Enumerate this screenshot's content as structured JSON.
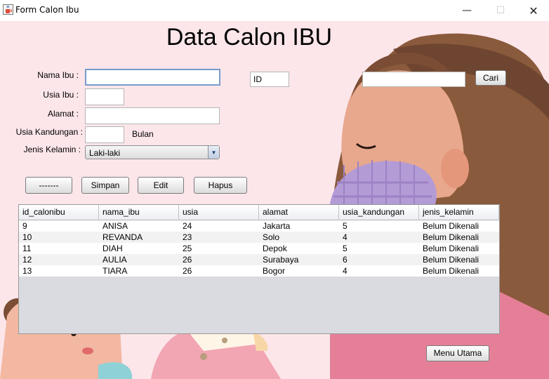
{
  "window": {
    "title": "Form Calon Ibu",
    "minimize": "—",
    "maximize": "☐",
    "close": "✕"
  },
  "page": {
    "heading": "Data Calon IBU"
  },
  "form": {
    "nama_label": "Nama Ibu :",
    "nama_value": "",
    "usia_label": "Usia Ibu :",
    "usia_value": "",
    "alamat_label": "Alamat :",
    "alamat_value": "",
    "kandungan_label": "Usia Kandungan :",
    "kandungan_value": "",
    "bulan_label": "Bulan",
    "kelamin_label": "Jenis Kelamin :",
    "kelamin_value": "Laki-laki",
    "id_value": "ID",
    "search_value": ""
  },
  "buttons": {
    "blank": "-------",
    "simpan": "Simpan",
    "edit": "Edit",
    "hapus": "Hapus",
    "cari": "Cari",
    "menu_utama": "Menu Utama"
  },
  "table": {
    "columns": [
      "id_calonibu",
      "nama_ibu",
      "usia",
      "alamat",
      "usia_kandungan",
      "jenis_kelamin"
    ],
    "rows": [
      [
        "9",
        "ANISA",
        "24",
        "Jakarta",
        "5",
        "Belum Dikenali"
      ],
      [
        "10",
        "REVANDA",
        "23",
        "Solo",
        "4",
        "Belum Dikenali"
      ],
      [
        "11",
        "DIAH",
        "25",
        "Depok",
        "5",
        "Belum Dikenali"
      ],
      [
        "12",
        "AULIA",
        "26",
        "Surabaya",
        "6",
        "Belum Dikenali"
      ],
      [
        "13",
        "TIARA",
        "26",
        "Bogor",
        "4",
        "Belum Dikenali"
      ]
    ]
  },
  "icons": {
    "app": "java-cup-icon",
    "dropdown": "triangle-down-icon"
  },
  "colors": {
    "background": "#fce6ea",
    "hair": "#8a5a3c",
    "skin": "#e8a88e",
    "scarf": "#b39bd6",
    "dress": "#e57f98"
  }
}
